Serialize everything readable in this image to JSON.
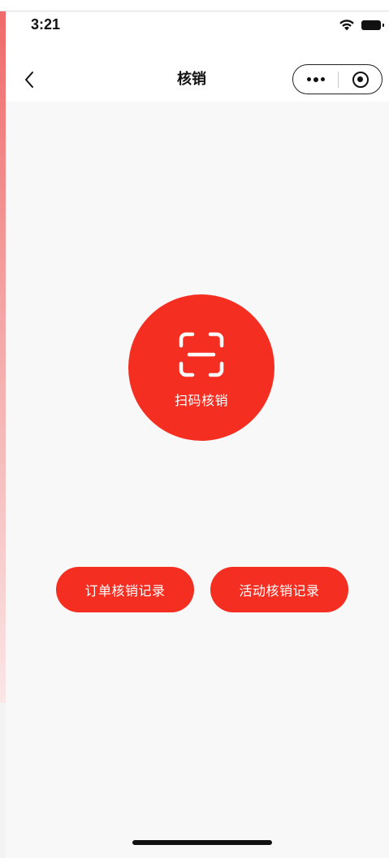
{
  "status_bar": {
    "time": "3:21",
    "wifi_icon": "wifi-icon",
    "battery_icon": "battery-icon"
  },
  "nav_bar": {
    "title": "核销",
    "back_icon": "chevron-left-icon",
    "more_icon": "more-dots-icon",
    "close_icon": "target-circle-icon"
  },
  "main": {
    "scan_button": {
      "icon": "scan-frame-icon",
      "label": "扫码核销"
    },
    "order_records_label": "订单核销记录",
    "activity_records_label": "活动核销记录"
  },
  "colors": {
    "accent": "#f52e22",
    "background": "#f8f8f8",
    "header_bg": "#ffffff"
  }
}
